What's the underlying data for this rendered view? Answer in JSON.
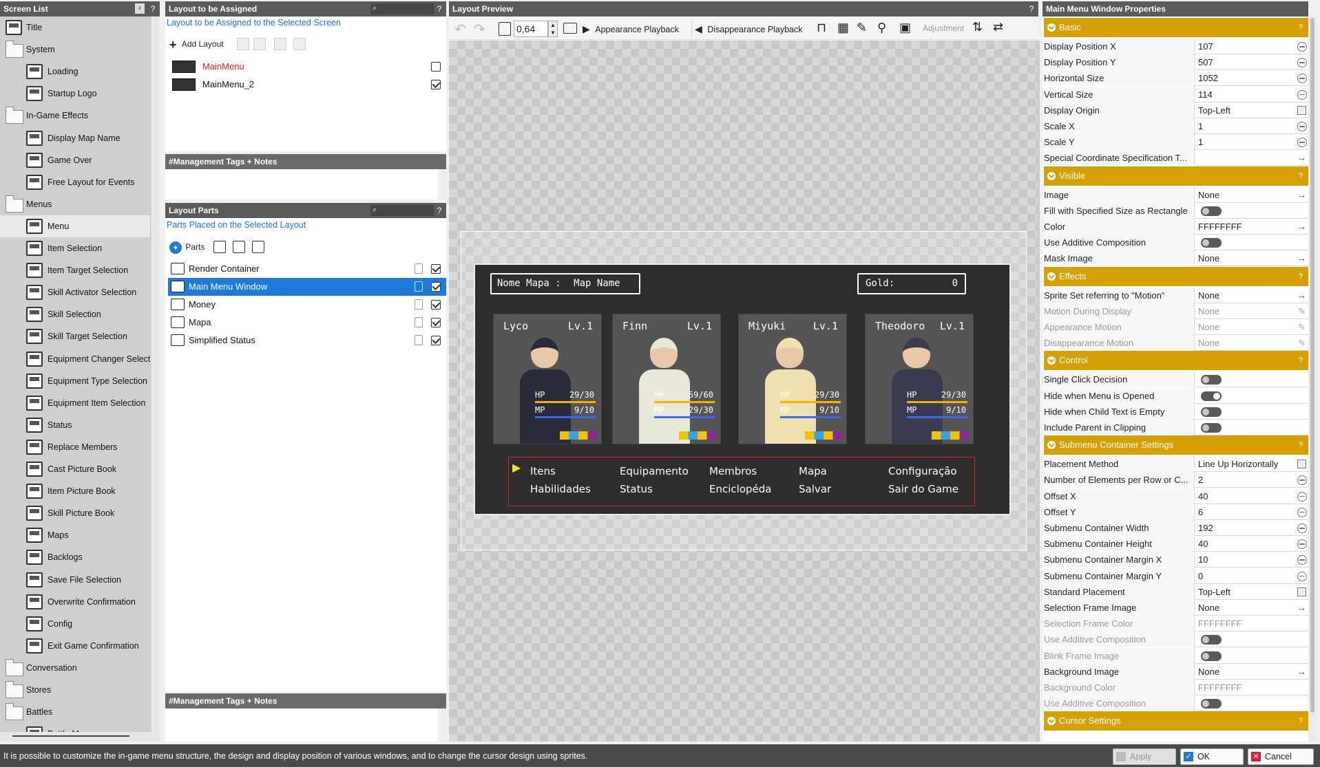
{
  "screen_list": {
    "title": "Screen List",
    "help": "?",
    "items": [
      {
        "label": "Title",
        "type": "item",
        "indent": 0
      },
      {
        "label": "System",
        "type": "folder",
        "indent": 0
      },
      {
        "label": "Loading",
        "type": "item",
        "indent": 1
      },
      {
        "label": "Startup Logo",
        "type": "item",
        "indent": 1
      },
      {
        "label": "In-Game Effects",
        "type": "folder",
        "indent": 0
      },
      {
        "label": "Display Map Name",
        "type": "item",
        "indent": 1
      },
      {
        "label": "Game Over",
        "type": "item",
        "indent": 1
      },
      {
        "label": "Free Layout for Events",
        "type": "item",
        "indent": 1
      },
      {
        "label": "Menus",
        "type": "folder",
        "indent": 0
      },
      {
        "label": "Menu",
        "type": "item",
        "indent": 1,
        "selected": true
      },
      {
        "label": "Item Selection",
        "type": "item",
        "indent": 1
      },
      {
        "label": "Item Target Selection",
        "type": "item",
        "indent": 1
      },
      {
        "label": "Skill Activator Selection",
        "type": "item",
        "indent": 1
      },
      {
        "label": "Skill Selection",
        "type": "item",
        "indent": 1
      },
      {
        "label": "Skill Target Selection",
        "type": "item",
        "indent": 1
      },
      {
        "label": "Equipment Changer Selecti",
        "type": "item",
        "indent": 1
      },
      {
        "label": "Equipment Type Selection",
        "type": "item",
        "indent": 1
      },
      {
        "label": "Equipment Item Selection",
        "type": "item",
        "indent": 1
      },
      {
        "label": "Status",
        "type": "item",
        "indent": 1
      },
      {
        "label": "Replace Members",
        "type": "item",
        "indent": 1
      },
      {
        "label": "Cast Picture Book",
        "type": "item",
        "indent": 1
      },
      {
        "label": "Item Picture Book",
        "type": "item",
        "indent": 1
      },
      {
        "label": "Skill Picture Book",
        "type": "item",
        "indent": 1
      },
      {
        "label": "Maps",
        "type": "item",
        "indent": 1
      },
      {
        "label": "Backlogs",
        "type": "item",
        "indent": 1
      },
      {
        "label": "Save File Selection",
        "type": "item",
        "indent": 1
      },
      {
        "label": "Overwrite Confirmation",
        "type": "item",
        "indent": 1
      },
      {
        "label": "Config",
        "type": "item",
        "indent": 1
      },
      {
        "label": "Exit Game Confirmation",
        "type": "item",
        "indent": 1
      },
      {
        "label": "Conversation",
        "type": "folder",
        "indent": 0
      },
      {
        "label": "Stores",
        "type": "folder",
        "indent": 0
      },
      {
        "label": "Battles",
        "type": "folder",
        "indent": 0
      },
      {
        "label": "Battle M...",
        "type": "item",
        "indent": 1
      }
    ]
  },
  "layout_assign": {
    "title": "Layout to be Assigned",
    "help": "?",
    "subtitle": "Layout to be Assigned to the Selected Screen",
    "add_label": "Add Layout",
    "layouts": [
      {
        "name": "MainMenu",
        "checked": false,
        "active": true
      },
      {
        "name": "MainMenu_2",
        "checked": true,
        "active": false
      }
    ],
    "notes_title": "#Management Tags + Notes"
  },
  "layout_parts": {
    "title": "Layout Parts",
    "help": "?",
    "subtitle": "Parts Placed on the Selected Layout",
    "parts_label": "Parts",
    "parts": [
      {
        "name": "Render Container",
        "selected": false
      },
      {
        "name": "Main Menu Window",
        "selected": true
      },
      {
        "name": "Money",
        "selected": false
      },
      {
        "name": "Mapa",
        "selected": false
      },
      {
        "name": "Simplified Status",
        "selected": false
      }
    ],
    "notes_title": "#Management Tags + Notes"
  },
  "preview": {
    "title": "Layout Preview",
    "help": "?",
    "zoom": "0,64",
    "appearance_label": "Appearance Playback",
    "disappearance_label": "Disappearance Playback",
    "adjustment_label": "Adjustment",
    "game": {
      "map_label": "Nome Mapa :",
      "map_name": "Map Name",
      "gold_label": "Gold:",
      "gold_value": "0",
      "characters": [
        {
          "name": "Lyco",
          "lv": "Lv.1",
          "hp_label": "HP",
          "hp": "29/30",
          "mp_label": "MP",
          "mp": "9/10",
          "color": "#2a2a3a"
        },
        {
          "name": "Finn",
          "lv": "Lv.1",
          "hp_label": "HP",
          "hp": "59/60",
          "mp_label": "MP",
          "mp": "29/30",
          "color": "#e8e8d8"
        },
        {
          "name": "Miyuki",
          "lv": "Lv.1",
          "hp_label": "HP",
          "hp": "29/30",
          "mp_label": "MP",
          "mp": "9/10",
          "color": "#f0e0b0"
        },
        {
          "name": "Theodoro",
          "lv": "Lv.1",
          "hp_label": "HP",
          "hp": "29/30",
          "mp_label": "MP",
          "mp": "9/10",
          "color": "#3a3a50"
        }
      ],
      "menu": [
        [
          "Itens",
          "Equipamento",
          "Membros",
          "Mapa",
          "Configuração"
        ],
        [
          "Habilidades",
          "Status",
          "Enciclopéda",
          "Salvar",
          "Sair do Game"
        ]
      ]
    }
  },
  "properties": {
    "title": "Main Menu Window Properties",
    "help": "?",
    "sections": [
      {
        "name": "Basic",
        "rows": [
          {
            "n": "Display Position X",
            "v": "107",
            "w": "num"
          },
          {
            "n": "Display Position Y",
            "v": "507",
            "w": "num"
          },
          {
            "n": "Horizontal Size",
            "v": "1052",
            "w": "num"
          },
          {
            "n": "Vertical Size",
            "v": "114",
            "w": "num"
          },
          {
            "n": "Display Origin",
            "v": "Top-Left",
            "w": "sel"
          },
          {
            "n": "Scale X",
            "v": "1",
            "w": "num"
          },
          {
            "n": "Scale Y",
            "v": "1",
            "w": "num"
          },
          {
            "n": "Special Coordinate Specification T...",
            "v": "",
            "w": "arr"
          }
        ]
      },
      {
        "name": "Visible",
        "rows": [
          {
            "n": "Image",
            "v": "None",
            "w": "arr"
          },
          {
            "n": "Fill with Specified Size as Rectangle",
            "v": "",
            "w": "tog"
          },
          {
            "n": "Color",
            "v": "FFFFFFFF",
            "w": "arr"
          },
          {
            "n": "Use Additive Composition",
            "v": "",
            "w": "tog"
          },
          {
            "n": "Mask Image",
            "v": "None",
            "w": "arr"
          }
        ]
      },
      {
        "name": "Effects",
        "rows": [
          {
            "n": "Sprite Set referring to \"Motion\"",
            "v": "None",
            "w": "arr"
          },
          {
            "n": "Motion During Display",
            "v": "None",
            "w": "edit",
            "dis": true
          },
          {
            "n": "Appearance Motion",
            "v": "None",
            "w": "edit",
            "dis": true
          },
          {
            "n": "Disappearance Motion",
            "v": "None",
            "w": "edit",
            "dis": true
          }
        ]
      },
      {
        "name": "Control",
        "rows": [
          {
            "n": "Single Click Decision",
            "v": "",
            "w": "tog"
          },
          {
            "n": "Hide when Menu is Opened",
            "v": "",
            "w": "togon"
          },
          {
            "n": "Hide when Child Text is Empty",
            "v": "",
            "w": "tog"
          },
          {
            "n": "Include Parent in Clipping",
            "v": "",
            "w": "tog"
          }
        ]
      },
      {
        "name": "Submenu Container Settings",
        "rows": [
          {
            "n": "Placement Method",
            "v": "Line Up Horizontally",
            "w": "sel"
          },
          {
            "n": "Number of Elements per Row or C...",
            "v": "2",
            "w": "num"
          },
          {
            "n": "Offset X",
            "v": "40",
            "w": "num"
          },
          {
            "n": "Offset Y",
            "v": "6",
            "w": "num"
          },
          {
            "n": "Submenu Container Width",
            "v": "192",
            "w": "num"
          },
          {
            "n": "Submenu Container Height",
            "v": "40",
            "w": "num"
          },
          {
            "n": "Submenu Container Margin X",
            "v": "10",
            "w": "num"
          },
          {
            "n": "Submenu Container Margin Y",
            "v": "0",
            "w": "num"
          },
          {
            "n": "Standard Placement",
            "v": "Top-Left",
            "w": "sel"
          },
          {
            "n": "Selection Frame Image",
            "v": "None",
            "w": "arr"
          },
          {
            "n": "Selection Frame Color",
            "v": "FFFFFFFF",
            "w": "none",
            "dis": true
          },
          {
            "n": "Use Additive Composition",
            "v": "",
            "w": "tog",
            "dis": true
          },
          {
            "n": "Blink Frame Image",
            "v": "",
            "w": "tog",
            "dis": true
          },
          {
            "n": "Background Image",
            "v": "None",
            "w": "arr"
          },
          {
            "n": "Background Color",
            "v": "FFFFFFFF",
            "w": "none",
            "dis": true
          },
          {
            "n": "Use Additive Composition",
            "v": "",
            "w": "tog",
            "dis": true
          }
        ]
      },
      {
        "name": "Cursor Settings",
        "rows": []
      }
    ]
  },
  "status_bar": {
    "text": "It is possible to customize the in-game menu structure, the design and display position of various windows, and to change the cursor design using sprites.",
    "apply": "Apply",
    "ok": "OK",
    "cancel": "Cancel"
  },
  "colors": {
    "accent": "#d4a004",
    "selection": "#1f7ad8",
    "title_bar": "#5b5b5b"
  }
}
